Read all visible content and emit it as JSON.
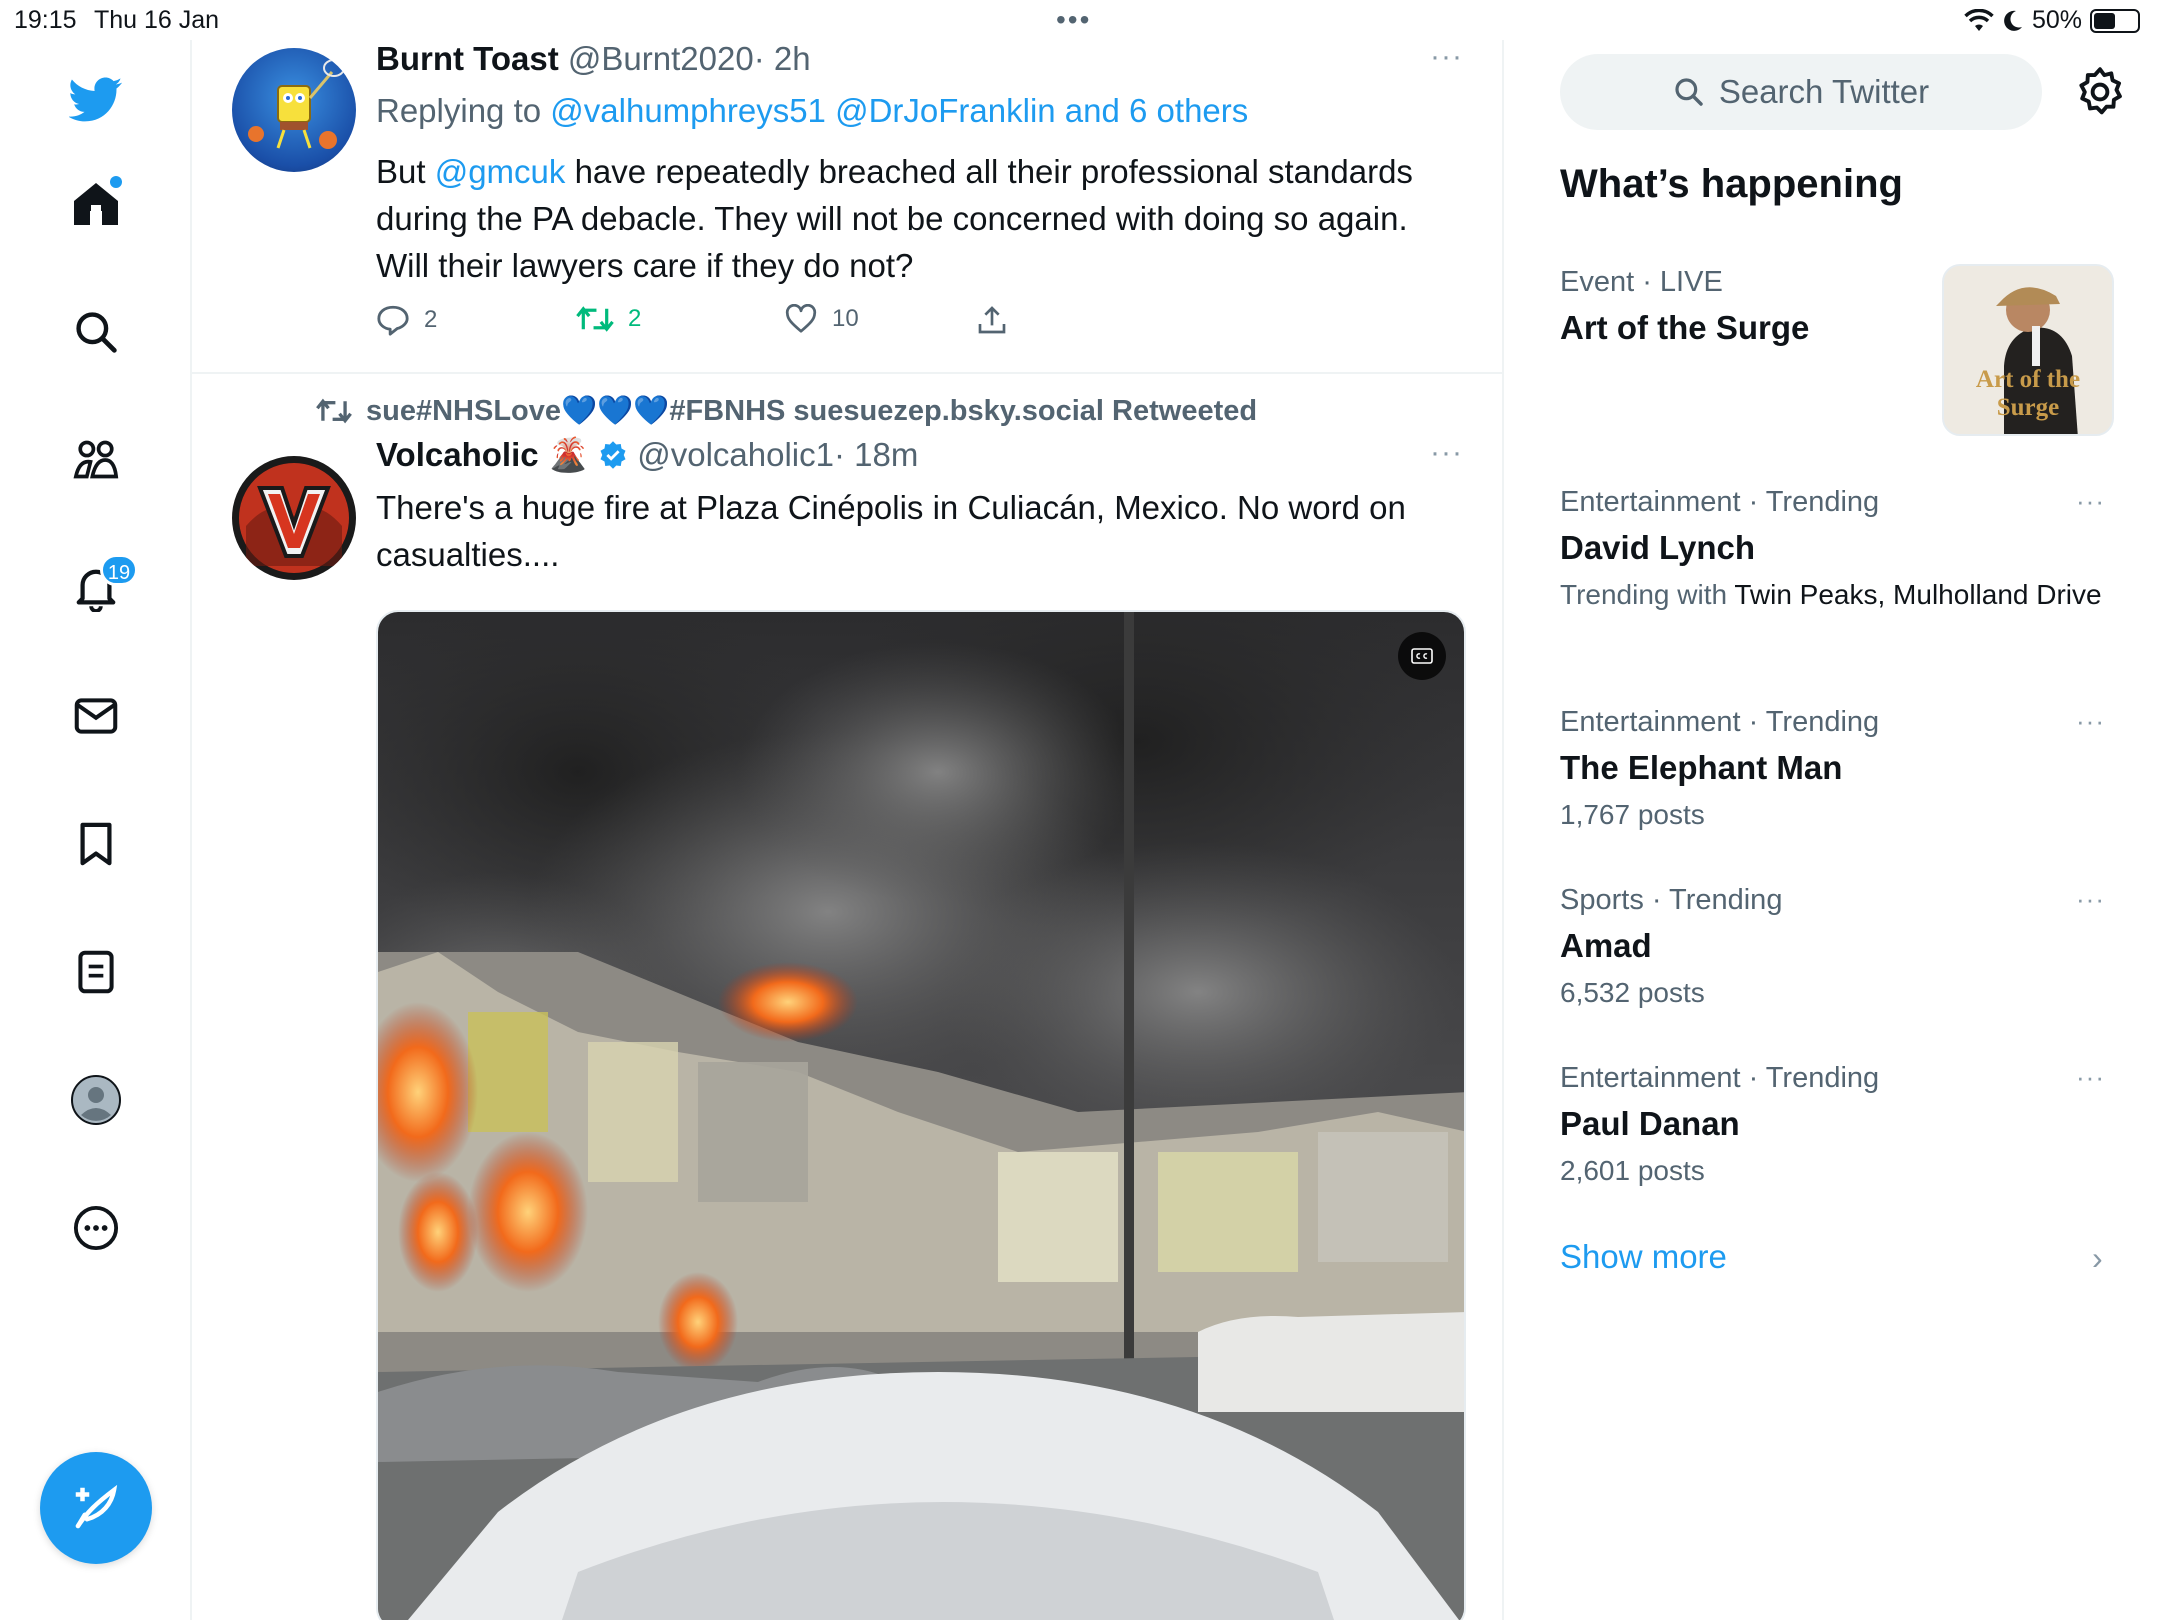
{
  "status_bar": {
    "time": "19:15",
    "date": "Thu 16 Jan",
    "battery_text": "50%",
    "battery_level": 0.5
  },
  "nav": {
    "notifications_badge": "19",
    "items": [
      "twitter-logo",
      "home-icon",
      "search-icon",
      "communities-icon",
      "notifications-icon",
      "messages-icon",
      "bookmarks-icon",
      "lists-icon",
      "profile-icon",
      "more-icon"
    ]
  },
  "tweet1": {
    "name": "Burnt Toast",
    "handle": "@Burnt2020",
    "time": "· 2h",
    "replying_prefix": "Replying to",
    "replying_users": "@valhumphreys51 @DrJoFranklin and 6 others",
    "text_before": "But ",
    "mention": "@gmcuk",
    "text_after": " have repeatedly breached all their professional standards during the PA debacle. They will not be concerned with doing so again. Will their lawyers care if they do not?",
    "replies": "2",
    "retweets": "2",
    "likes": "10",
    "more": "···"
  },
  "tweet2": {
    "retweeted_by": "sue#NHSLove💙💙💙#FBNHS suesuezep.bsky.social Retweeted",
    "name": "Volcaholic",
    "name_emoji": "🌋",
    "handle": "@volcaholic1",
    "time": "· 18m",
    "text": "There's a huge fire at Plaza Cinépolis in Culiacán, Mexico. No word on casualties....",
    "more": "···"
  },
  "sidebar": {
    "search_placeholder": "Search Twitter",
    "heading": "What’s happening",
    "trends": [
      {
        "category": "Event · LIVE",
        "title": "Art of the Surge",
        "sub": ""
      },
      {
        "category": "Entertainment · Trending",
        "title": "David Lynch",
        "sub_prefix": "Trending with ",
        "sub": "Twin Peaks, Mulholland Drive"
      },
      {
        "category": "Entertainment · Trending",
        "title": "The Elephant Man",
        "sub": "1,767 posts"
      },
      {
        "category": "Sports · Trending",
        "title": "Amad",
        "sub": "6,532 posts"
      },
      {
        "category": "Entertainment · Trending",
        "title": "Paul Danan",
        "sub": "2,601 posts"
      }
    ],
    "thumb_text": "Art of the Surge",
    "trend_more": "···",
    "show_more": "Show more"
  },
  "colors": {
    "accent": "#1d9bf0",
    "retweet_green": "#00ba7c",
    "muted": "#536471",
    "text": "#0f1419"
  }
}
